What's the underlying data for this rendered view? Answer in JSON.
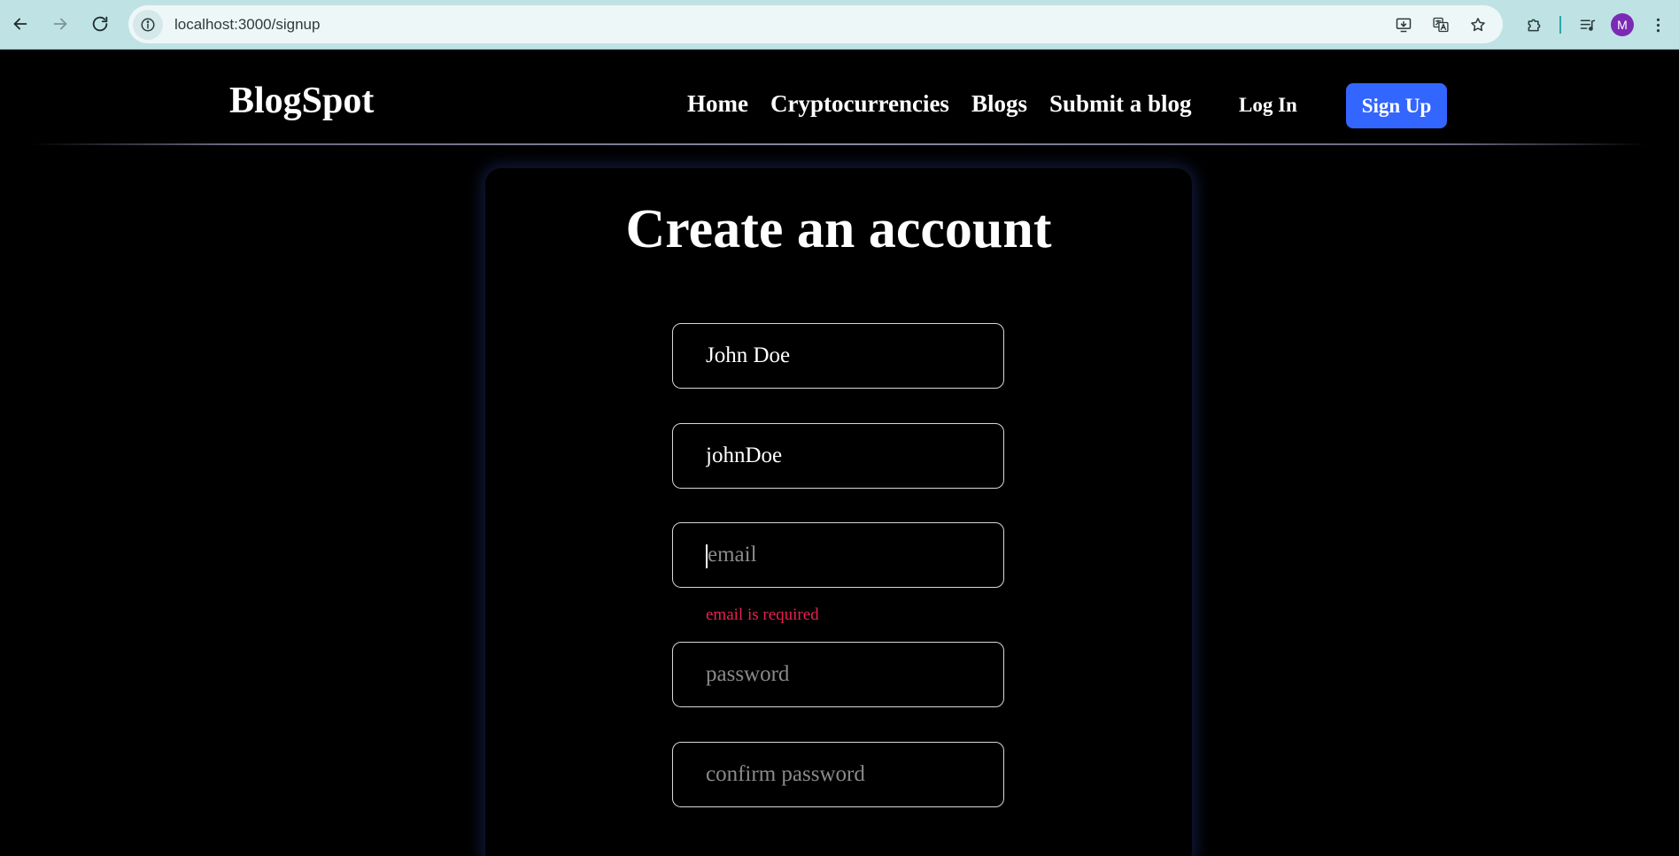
{
  "browser": {
    "url": "localhost:3000/signup",
    "profile_initial": "M",
    "colors": {
      "toolbar": "#bfe3e5",
      "omnibox": "#eef7f7",
      "profile": "#7b2ab5"
    }
  },
  "header": {
    "brand": "BlogSpot",
    "nav": [
      "Home",
      "Cryptocurrencies",
      "Blogs",
      "Submit a blog"
    ],
    "login_label": "Log In",
    "signup_label": "Sign Up",
    "colors": {
      "signup_button": "#3366ff"
    }
  },
  "form": {
    "title": "Create an account",
    "fields": {
      "fullname": {
        "value": "John Doe",
        "placeholder": ""
      },
      "username": {
        "value": "johnDoe",
        "placeholder": ""
      },
      "email": {
        "value": "",
        "placeholder": "email"
      },
      "password": {
        "value": "",
        "placeholder": "password"
      },
      "confirm_password": {
        "value": "",
        "placeholder": "confirm password"
      }
    },
    "email_error": "email is required",
    "colors": {
      "error": "#e8224e"
    }
  }
}
